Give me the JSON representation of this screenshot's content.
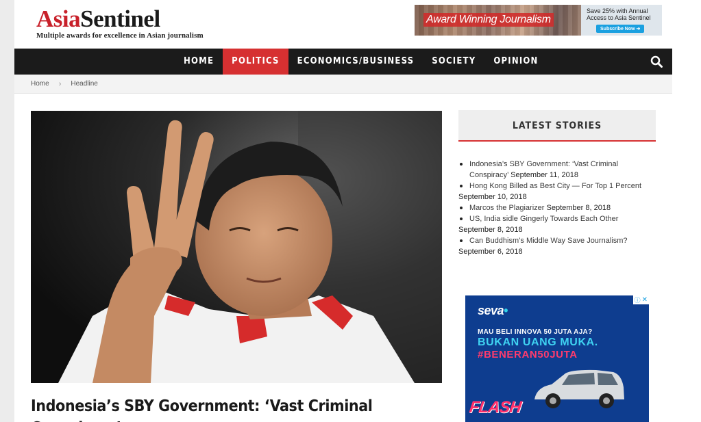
{
  "header": {
    "logo_asia": "Asia",
    "logo_sentinel": "Sentinel",
    "tagline": "Multiple awards for excellence in Asian journalism"
  },
  "banner": {
    "slogan": "Award Winning Journalism",
    "offer": "Save 25% with Annual Access to Asia Sentinel",
    "button": "Subscribe Now"
  },
  "nav": {
    "items": [
      {
        "label": "HOME",
        "active": false
      },
      {
        "label": "POLITICS",
        "active": true
      },
      {
        "label": "ECONOMICS/BUSINESS",
        "active": false
      },
      {
        "label": "SOCIETY",
        "active": false
      },
      {
        "label": "OPINION",
        "active": false
      }
    ],
    "search_icon": "search-icon"
  },
  "breadcrumb": {
    "home": "Home",
    "current": "Headline"
  },
  "article": {
    "headline": "Indonesia’s SBY Government: ‘Vast Criminal Conspiracy’"
  },
  "sidebar": {
    "latest_title": "LATEST STORIES",
    "stories": [
      {
        "title": "Indonesia’s SBY Government: ‘Vast Criminal Conspiracy’",
        "date": "September 11, 2018"
      },
      {
        "title": "Hong Kong Billed as Best City — For Top 1 Percent",
        "date": "September 10, 2018"
      },
      {
        "title": "Marcos the Plagiarizer",
        "date": "September 8, 2018"
      },
      {
        "title": "US, India sidle Gingerly Towards Each Other",
        "date": "September 8, 2018"
      },
      {
        "title": "Can Buddhism’s Middle Way Save Journalism?",
        "date": "September 6, 2018"
      }
    ]
  },
  "ad": {
    "brand": "seva",
    "line1": "MAU BELI INNOVA 50 JUTA AJA?",
    "line2": "BUKAN UANG MUKA.",
    "line3": "#BENERAN50JUTA",
    "flash": "FLASH"
  },
  "colors": {
    "accent": "#d63031",
    "nav_bg": "#1b1b1b",
    "ad_bg": "#0e3d8f"
  }
}
